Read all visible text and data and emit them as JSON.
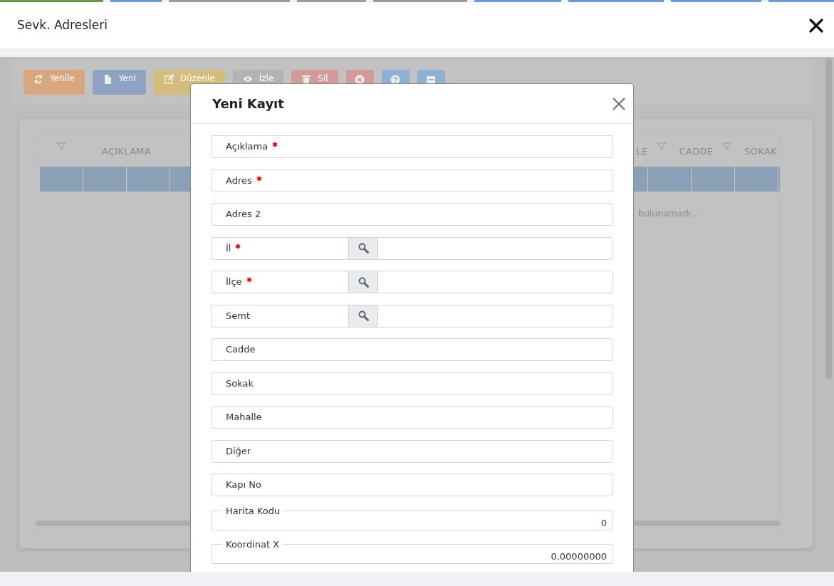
{
  "window": {
    "title": "Sevk. Adresleri"
  },
  "background_tabs": [
    {
      "color": "#6a9a4a"
    },
    {
      "color": "#6a9bd8"
    },
    {
      "color": "#9a9a9a"
    },
    {
      "color": "#9a9a9a"
    },
    {
      "color": "#9a9a9a"
    },
    {
      "color": "#6a9bd8"
    },
    {
      "color": "#6a9bd8"
    },
    {
      "color": "#6a9bd8"
    },
    {
      "color": "#6a9bd8"
    }
  ],
  "toolbar": [
    {
      "kind": "refresh",
      "label": "Yenile",
      "color": "#d9a77e"
    },
    {
      "kind": "file",
      "label": "Yeni",
      "color": "#8ea3c4"
    },
    {
      "kind": "edit",
      "label": "Düzenle",
      "color": "#d4bd7c"
    },
    {
      "kind": "eye",
      "label": "İzle",
      "color": "#b3b3b3"
    },
    {
      "kind": "trash",
      "label": "Sil",
      "color": "#d39a9a"
    },
    {
      "kind": "cancel",
      "color": "#d39a9a"
    },
    {
      "kind": "help",
      "color": "#8fb0d2"
    },
    {
      "kind": "form",
      "color": "#8fb0d2"
    }
  ],
  "grid": {
    "columns_left": [
      {
        "label": "AÇIKLAMA",
        "filter": true
      }
    ],
    "columns_right": [
      {
        "label": "LE",
        "filter": false
      },
      {
        "label": "CADDE",
        "filter": true
      },
      {
        "label": "SOKAK",
        "filter": true
      }
    ],
    "rows": [
      {
        "selected": true
      }
    ],
    "empty_text": "bulunamadı..."
  },
  "dialog": {
    "title": "Yeni Kayıt",
    "fields": [
      {
        "kind": "text",
        "label": "Açıklama",
        "required": true
      },
      {
        "kind": "text",
        "label": "Adres",
        "required": true
      },
      {
        "kind": "text",
        "label": "Adres 2",
        "required": false
      },
      {
        "kind": "lookup",
        "label": "İl",
        "required": true
      },
      {
        "kind": "lookup",
        "label": "İlçe",
        "required": true
      },
      {
        "kind": "lookup",
        "label": "Semt",
        "required": false
      },
      {
        "kind": "text",
        "label": "Cadde",
        "required": false
      },
      {
        "kind": "text",
        "label": "Sokak",
        "required": false
      },
      {
        "kind": "text",
        "label": "Mahalle",
        "required": false
      },
      {
        "kind": "text",
        "label": "Diğer",
        "required": false
      },
      {
        "kind": "text",
        "label": "Kapı No",
        "required": false
      },
      {
        "kind": "number",
        "label": "Harita Kodu",
        "value": "0"
      },
      {
        "kind": "number",
        "label": "Koordinat X",
        "value": "0.00000000"
      }
    ]
  }
}
